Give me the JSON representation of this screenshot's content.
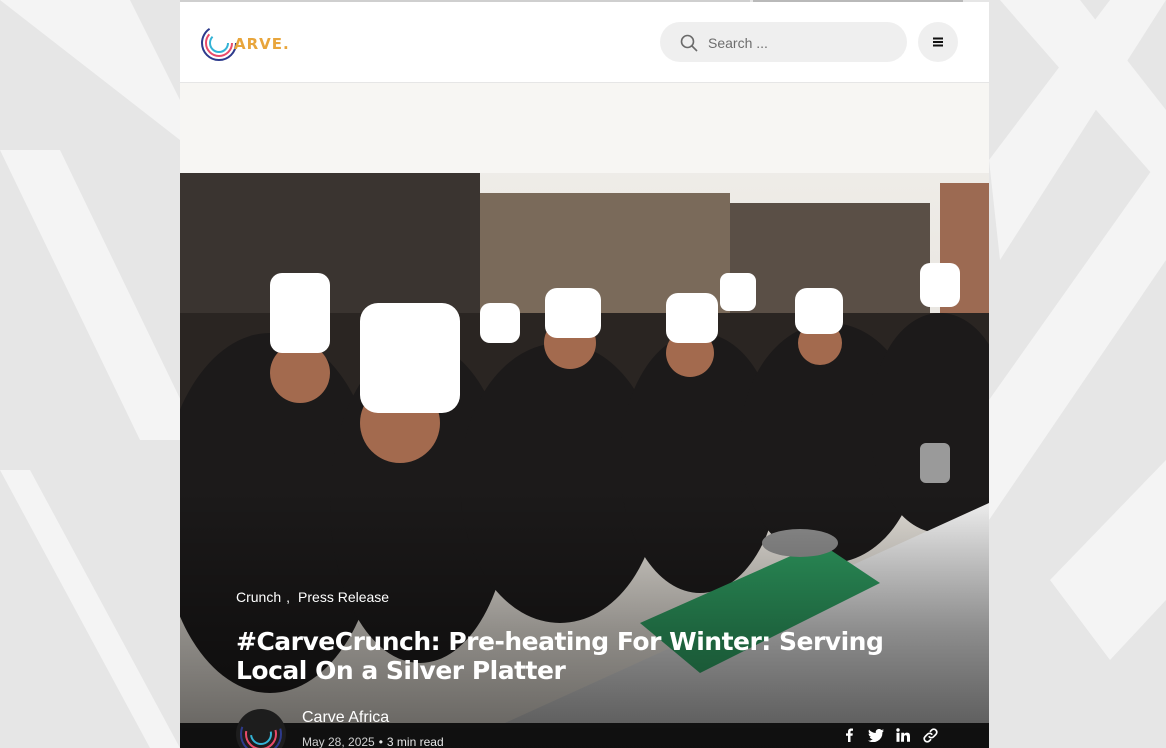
{
  "header": {
    "logo_text": "ARVE.",
    "search": {
      "placeholder": "Search ..."
    }
  },
  "post": {
    "categories": [
      "Crunch",
      "Press Release"
    ],
    "category_separator": ",",
    "title": "#CarveCrunch: Pre-heating For Winter: Serving Local On a Silver Platter",
    "author": "Carve Africa",
    "date": "May 28, 2025",
    "read_time": "3 min read"
  },
  "share": [
    "facebook-icon",
    "twitter-icon",
    "linkedin-icon",
    "link-icon"
  ],
  "colors": {
    "page_bg": "#e6e6e6",
    "search_bg": "#efefef",
    "text_white": "#ffffff"
  }
}
